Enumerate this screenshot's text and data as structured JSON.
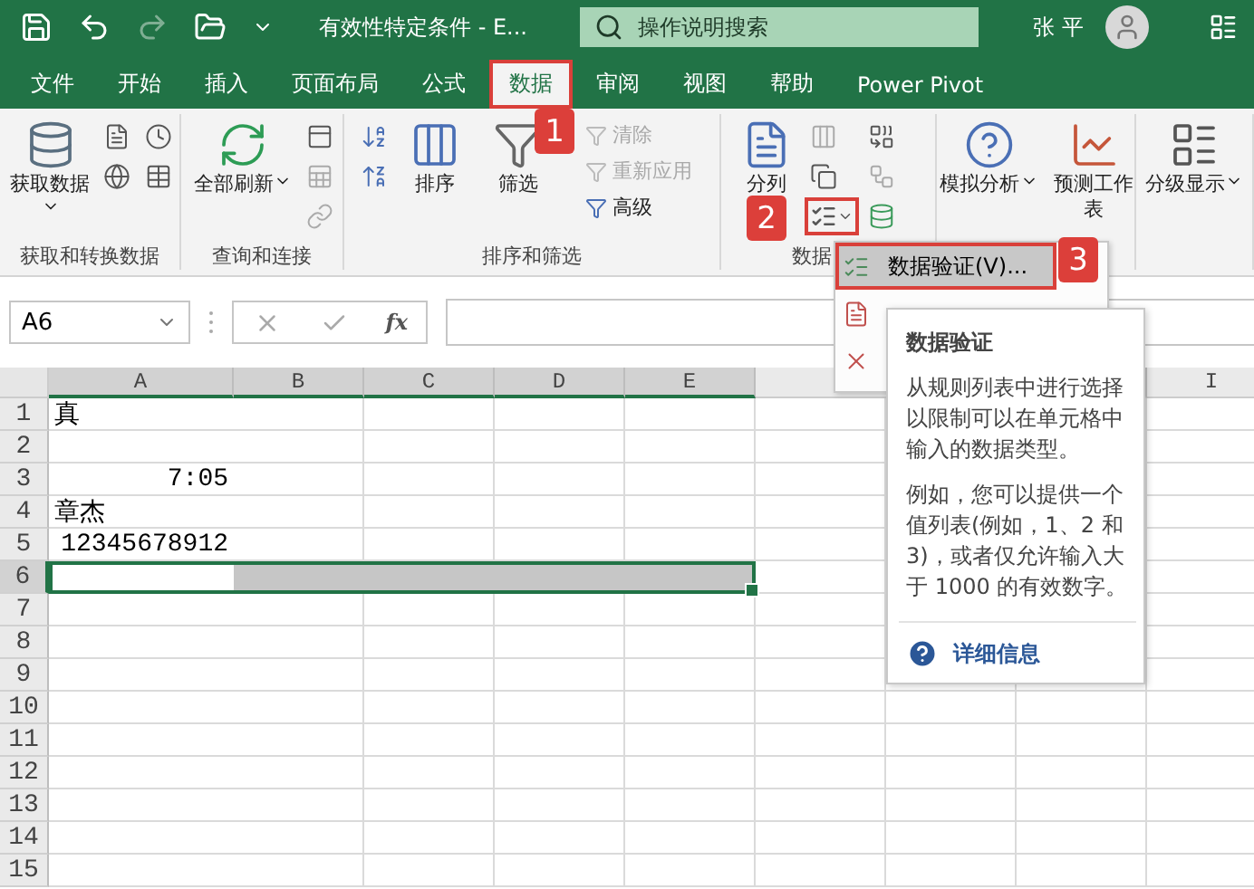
{
  "window": {
    "title": "有效性特定条件 - E...",
    "search": {
      "placeholder": "操作说明搜索"
    },
    "user": "张 平"
  },
  "tabs": [
    {
      "label": "文件",
      "selected": false
    },
    {
      "label": "开始",
      "selected": false
    },
    {
      "label": "插入",
      "selected": false
    },
    {
      "label": "页面布局",
      "selected": false
    },
    {
      "label": "公式",
      "selected": false
    },
    {
      "label": "数据",
      "selected": true
    },
    {
      "label": "审阅",
      "selected": false
    },
    {
      "label": "视图",
      "selected": false
    },
    {
      "label": "帮助",
      "selected": false
    },
    {
      "label": "Power Pivot",
      "selected": false
    }
  ],
  "ribbon": {
    "groups": [
      {
        "label": "获取和转换数据",
        "big": [
          {
            "label": "获取数据",
            "dropdown": true
          }
        ]
      },
      {
        "label": "查询和连接",
        "big": [
          {
            "label": "全部刷新",
            "dropdown": true
          }
        ]
      },
      {
        "label": "排序和筛选",
        "big": [
          {
            "label": "排序",
            "dropdown": false
          },
          {
            "label": "筛选",
            "dropdown": false
          }
        ],
        "small": [
          {
            "label": "清除",
            "disabled": true
          },
          {
            "label": "重新应用",
            "disabled": true
          },
          {
            "label": "高级",
            "disabled": false
          }
        ]
      },
      {
        "label": "数据",
        "big": [
          {
            "label": "分列",
            "dropdown": false
          }
        ]
      },
      {
        "big": [
          {
            "label": "模拟分析",
            "dropdown": true
          },
          {
            "label": "预测工作表",
            "dropdown": false
          }
        ]
      },
      {
        "big": [
          {
            "label": "分级显示",
            "dropdown": true
          }
        ]
      }
    ]
  },
  "formula_bar": {
    "name_box": "A6",
    "function_label": "fx"
  },
  "sheet": {
    "columns": [
      {
        "label": "A",
        "selected": true
      },
      {
        "label": "B",
        "selected": true
      },
      {
        "label": "C",
        "selected": true
      },
      {
        "label": "D",
        "selected": true
      },
      {
        "label": "E",
        "selected": true
      },
      {
        "label": "I",
        "selected": false
      }
    ],
    "rows": [
      {
        "label": "1",
        "selected": false,
        "cells": [
          {
            "text": "真",
            "kind": "text"
          }
        ]
      },
      {
        "label": "2",
        "selected": false,
        "cells": []
      },
      {
        "label": "3",
        "selected": false,
        "cells": [
          {
            "text": "7:05",
            "kind": "number"
          }
        ]
      },
      {
        "label": "4",
        "selected": false,
        "cells": [
          {
            "text": "章杰",
            "kind": "text"
          }
        ]
      },
      {
        "label": "5",
        "selected": false,
        "cells": [
          {
            "text": "12345678912",
            "kind": "number"
          }
        ]
      },
      {
        "label": "6",
        "selected": true,
        "cells": []
      },
      {
        "label": "7",
        "selected": false,
        "cells": []
      },
      {
        "label": "8",
        "selected": false,
        "cells": []
      },
      {
        "label": "9",
        "selected": false,
        "cells": []
      },
      {
        "label": "10",
        "selected": false,
        "cells": []
      },
      {
        "label": "11",
        "selected": false,
        "cells": []
      },
      {
        "label": "12",
        "selected": false,
        "cells": []
      },
      {
        "label": "13",
        "selected": false,
        "cells": []
      },
      {
        "label": "14",
        "selected": false,
        "cells": []
      },
      {
        "label": "15",
        "selected": false,
        "cells": []
      }
    ]
  },
  "menu": {
    "items": [
      {
        "label": "数据验证(V)...",
        "highlighted": true
      },
      {
        "highlighted": false
      },
      {
        "highlighted": false
      }
    ]
  },
  "tooltip": {
    "title": "数据验证",
    "paragraphs": [
      "从规则列表中进行选择以限制可以在单元格中输入的数据类型。",
      "例如，您可以提供一个值列表(例如，1、2 和 3)，或者仅允许输入大于 1000 的有效数字。"
    ],
    "link": "详细信息"
  },
  "callouts": [
    {
      "number": "1"
    },
    {
      "number": "2"
    },
    {
      "number": "3"
    }
  ]
}
